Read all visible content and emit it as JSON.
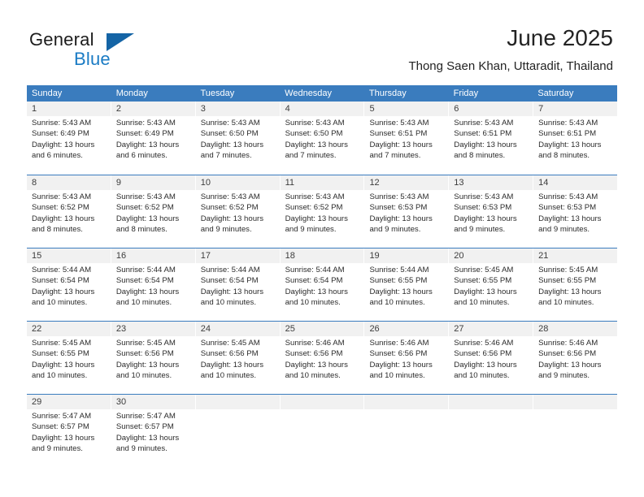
{
  "brand": {
    "word_one": "General",
    "word_two": "Blue",
    "triangle_color": "#1464a5",
    "blue_color": "#1a7bc4"
  },
  "header": {
    "month_title": "June 2025",
    "location": "Thong Saen Khan, Uttaradit, Thailand"
  },
  "calendar": {
    "header_color": "#3a7cbe",
    "daynum_band_color": "#f1f1f1",
    "weekdays": [
      "Sunday",
      "Monday",
      "Tuesday",
      "Wednesday",
      "Thursday",
      "Friday",
      "Saturday"
    ],
    "weeks": [
      [
        {
          "day": "1",
          "lines": [
            "Sunrise: 5:43 AM",
            "Sunset: 6:49 PM",
            "Daylight: 13 hours",
            "and 6 minutes."
          ]
        },
        {
          "day": "2",
          "lines": [
            "Sunrise: 5:43 AM",
            "Sunset: 6:49 PM",
            "Daylight: 13 hours",
            "and 6 minutes."
          ]
        },
        {
          "day": "3",
          "lines": [
            "Sunrise: 5:43 AM",
            "Sunset: 6:50 PM",
            "Daylight: 13 hours",
            "and 7 minutes."
          ]
        },
        {
          "day": "4",
          "lines": [
            "Sunrise: 5:43 AM",
            "Sunset: 6:50 PM",
            "Daylight: 13 hours",
            "and 7 minutes."
          ]
        },
        {
          "day": "5",
          "lines": [
            "Sunrise: 5:43 AM",
            "Sunset: 6:51 PM",
            "Daylight: 13 hours",
            "and 7 minutes."
          ]
        },
        {
          "day": "6",
          "lines": [
            "Sunrise: 5:43 AM",
            "Sunset: 6:51 PM",
            "Daylight: 13 hours",
            "and 8 minutes."
          ]
        },
        {
          "day": "7",
          "lines": [
            "Sunrise: 5:43 AM",
            "Sunset: 6:51 PM",
            "Daylight: 13 hours",
            "and 8 minutes."
          ]
        }
      ],
      [
        {
          "day": "8",
          "lines": [
            "Sunrise: 5:43 AM",
            "Sunset: 6:52 PM",
            "Daylight: 13 hours",
            "and 8 minutes."
          ]
        },
        {
          "day": "9",
          "lines": [
            "Sunrise: 5:43 AM",
            "Sunset: 6:52 PM",
            "Daylight: 13 hours",
            "and 8 minutes."
          ]
        },
        {
          "day": "10",
          "lines": [
            "Sunrise: 5:43 AM",
            "Sunset: 6:52 PM",
            "Daylight: 13 hours",
            "and 9 minutes."
          ]
        },
        {
          "day": "11",
          "lines": [
            "Sunrise: 5:43 AM",
            "Sunset: 6:52 PM",
            "Daylight: 13 hours",
            "and 9 minutes."
          ]
        },
        {
          "day": "12",
          "lines": [
            "Sunrise: 5:43 AM",
            "Sunset: 6:53 PM",
            "Daylight: 13 hours",
            "and 9 minutes."
          ]
        },
        {
          "day": "13",
          "lines": [
            "Sunrise: 5:43 AM",
            "Sunset: 6:53 PM",
            "Daylight: 13 hours",
            "and 9 minutes."
          ]
        },
        {
          "day": "14",
          "lines": [
            "Sunrise: 5:43 AM",
            "Sunset: 6:53 PM",
            "Daylight: 13 hours",
            "and 9 minutes."
          ]
        }
      ],
      [
        {
          "day": "15",
          "lines": [
            "Sunrise: 5:44 AM",
            "Sunset: 6:54 PM",
            "Daylight: 13 hours",
            "and 10 minutes."
          ]
        },
        {
          "day": "16",
          "lines": [
            "Sunrise: 5:44 AM",
            "Sunset: 6:54 PM",
            "Daylight: 13 hours",
            "and 10 minutes."
          ]
        },
        {
          "day": "17",
          "lines": [
            "Sunrise: 5:44 AM",
            "Sunset: 6:54 PM",
            "Daylight: 13 hours",
            "and 10 minutes."
          ]
        },
        {
          "day": "18",
          "lines": [
            "Sunrise: 5:44 AM",
            "Sunset: 6:54 PM",
            "Daylight: 13 hours",
            "and 10 minutes."
          ]
        },
        {
          "day": "19",
          "lines": [
            "Sunrise: 5:44 AM",
            "Sunset: 6:55 PM",
            "Daylight: 13 hours",
            "and 10 minutes."
          ]
        },
        {
          "day": "20",
          "lines": [
            "Sunrise: 5:45 AM",
            "Sunset: 6:55 PM",
            "Daylight: 13 hours",
            "and 10 minutes."
          ]
        },
        {
          "day": "21",
          "lines": [
            "Sunrise: 5:45 AM",
            "Sunset: 6:55 PM",
            "Daylight: 13 hours",
            "and 10 minutes."
          ]
        }
      ],
      [
        {
          "day": "22",
          "lines": [
            "Sunrise: 5:45 AM",
            "Sunset: 6:55 PM",
            "Daylight: 13 hours",
            "and 10 minutes."
          ]
        },
        {
          "day": "23",
          "lines": [
            "Sunrise: 5:45 AM",
            "Sunset: 6:56 PM",
            "Daylight: 13 hours",
            "and 10 minutes."
          ]
        },
        {
          "day": "24",
          "lines": [
            "Sunrise: 5:45 AM",
            "Sunset: 6:56 PM",
            "Daylight: 13 hours",
            "and 10 minutes."
          ]
        },
        {
          "day": "25",
          "lines": [
            "Sunrise: 5:46 AM",
            "Sunset: 6:56 PM",
            "Daylight: 13 hours",
            "and 10 minutes."
          ]
        },
        {
          "day": "26",
          "lines": [
            "Sunrise: 5:46 AM",
            "Sunset: 6:56 PM",
            "Daylight: 13 hours",
            "and 10 minutes."
          ]
        },
        {
          "day": "27",
          "lines": [
            "Sunrise: 5:46 AM",
            "Sunset: 6:56 PM",
            "Daylight: 13 hours",
            "and 10 minutes."
          ]
        },
        {
          "day": "28",
          "lines": [
            "Sunrise: 5:46 AM",
            "Sunset: 6:56 PM",
            "Daylight: 13 hours",
            "and 9 minutes."
          ]
        }
      ],
      [
        {
          "day": "29",
          "lines": [
            "Sunrise: 5:47 AM",
            "Sunset: 6:57 PM",
            "Daylight: 13 hours",
            "and 9 minutes."
          ]
        },
        {
          "day": "30",
          "lines": [
            "Sunrise: 5:47 AM",
            "Sunset: 6:57 PM",
            "Daylight: 13 hours",
            "and 9 minutes."
          ]
        },
        {
          "day": "",
          "lines": []
        },
        {
          "day": "",
          "lines": []
        },
        {
          "day": "",
          "lines": []
        },
        {
          "day": "",
          "lines": []
        },
        {
          "day": "",
          "lines": []
        }
      ]
    ]
  }
}
